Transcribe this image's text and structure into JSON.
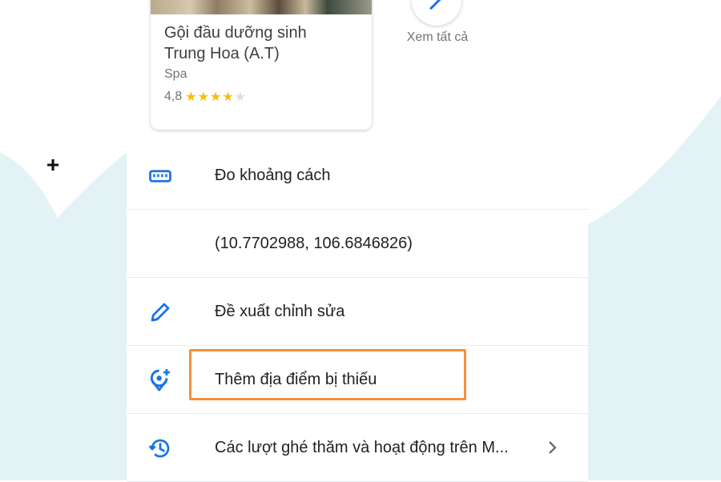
{
  "place": {
    "name_line1": "Gội đầu dưỡng sinh",
    "name_line2": "Trung Hoa (A.T)",
    "category": "Spa",
    "rating_text": "4,8",
    "rating_value": 4.8,
    "stars_filled": 4,
    "stars_total": 5
  },
  "view_all": {
    "label": "Xem tất cả",
    "icon": "arrow-icon"
  },
  "menu": {
    "items": [
      {
        "label": "Đo khoảng cách",
        "icon": "ruler-icon"
      },
      {
        "label": "(10.7702988, 106.6846826)",
        "icon": ""
      },
      {
        "label": "Đề xuất chỉnh sửa",
        "icon": "pencil-icon"
      },
      {
        "label": "Thêm địa điểm bị thiếu",
        "icon": "add-place-icon"
      },
      {
        "label": "Các lượt ghé thăm và hoạt động trên M...",
        "icon": "history-icon"
      }
    ]
  },
  "colors": {
    "icon_blue": "#1a73e8",
    "star_gold": "#fbbc04",
    "highlight_orange": "#f0913e",
    "background_wave": "#e3f3f5"
  }
}
